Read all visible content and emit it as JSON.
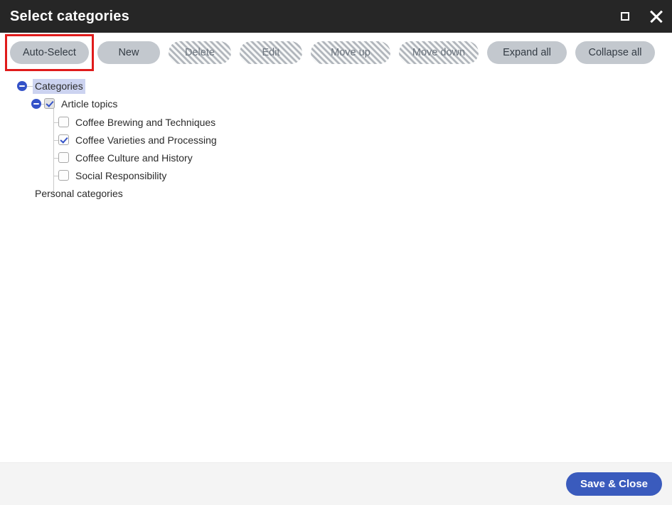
{
  "window": {
    "title": "Select categories",
    "controls": [
      {
        "name": "maximize-button",
        "icon": "maximize-icon"
      },
      {
        "name": "close-button",
        "icon": "close-icon"
      }
    ]
  },
  "toolbar": {
    "buttons": [
      {
        "label": "Auto-Select",
        "enabled": true,
        "highlighted": true
      },
      {
        "label": "New",
        "enabled": true,
        "highlighted": false
      },
      {
        "label": "Delete",
        "enabled": false,
        "highlighted": false
      },
      {
        "label": "Edit",
        "enabled": false,
        "highlighted": false
      },
      {
        "label": "Move up",
        "enabled": false,
        "highlighted": false
      },
      {
        "label": "Move down",
        "enabled": false,
        "highlighted": false
      },
      {
        "label": "Expand all",
        "enabled": true,
        "highlighted": false
      },
      {
        "label": "Collapse all",
        "enabled": true,
        "highlighted": false
      }
    ]
  },
  "tree": {
    "root": {
      "label": "Categories",
      "expanded": true,
      "selected": true,
      "has_checkbox": false
    },
    "group": {
      "label": "Article topics",
      "expanded": true,
      "checked": true,
      "shaded": true
    },
    "items": [
      {
        "label": "Coffee Brewing and Techniques",
        "checked": false
      },
      {
        "label": "Coffee Varieties and Processing",
        "checked": true
      },
      {
        "label": "Coffee Culture and History",
        "checked": false
      },
      {
        "label": "Social Responsibility",
        "checked": false
      }
    ],
    "personal": {
      "label": "Personal categories"
    }
  },
  "footer": {
    "save_label": "Save & Close"
  },
  "colors": {
    "titlebar_bg": "#262626",
    "accent_blue": "#3452c8",
    "save_button": "#3a5bbd",
    "highlight_red": "#e01b1b",
    "selection_bg": "#ccd3f0",
    "button_bg": "#c3c8ce",
    "footer_bg": "#f4f4f4"
  }
}
